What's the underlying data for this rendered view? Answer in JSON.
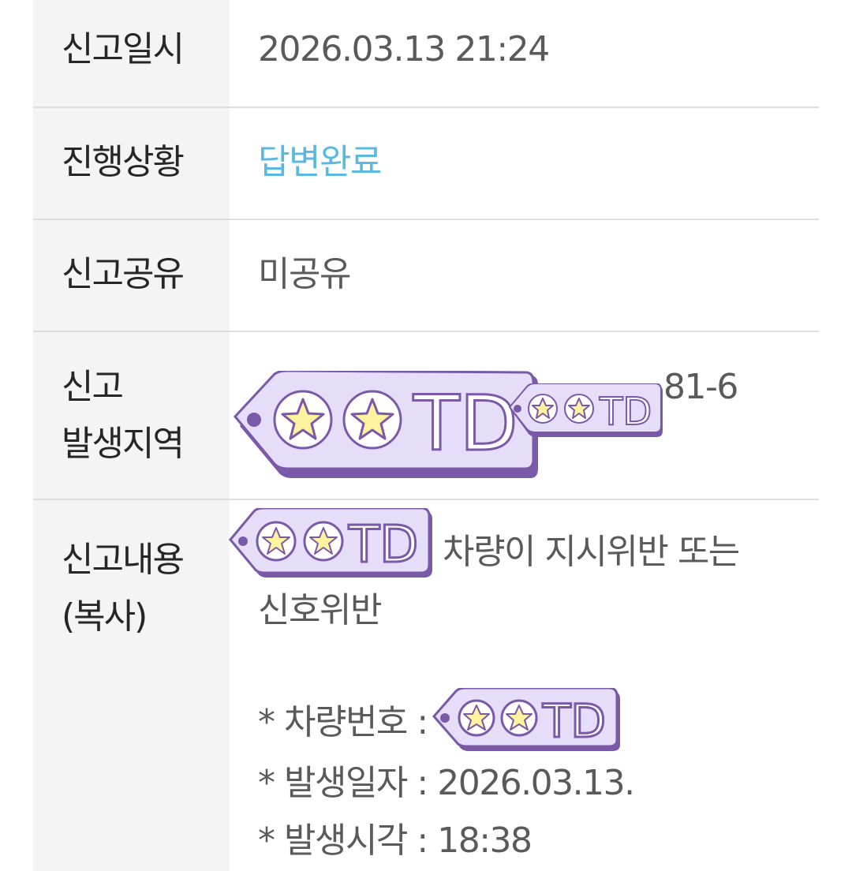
{
  "rows": {
    "report_datetime": {
      "label": "신고일시",
      "value": "2026.03.13 21:24"
    },
    "progress": {
      "label": "진행상황",
      "value": "답변완료",
      "value_color": "#5bb8e0"
    },
    "share": {
      "label": "신고공유",
      "value": "미공유"
    },
    "location": {
      "label_line1": "신고",
      "label_line2": "발생지역",
      "value_suffix": "81-6"
    },
    "content": {
      "label_line1": "신고내용",
      "label_line2": "(복사)",
      "text_line1": "차량이 지시위반 또는",
      "text_line2": "신호위반",
      "vehicle_number_label": "* 차량번호 :",
      "date_label": "* 발생일자 : 2026.03.13.",
      "time_label": "* 발생시각 : 18:38"
    }
  },
  "mask_tag": {
    "text": "TD",
    "fill": "#e6ddf9",
    "outline": "#7a5aa8",
    "star": "#fff3a0"
  }
}
